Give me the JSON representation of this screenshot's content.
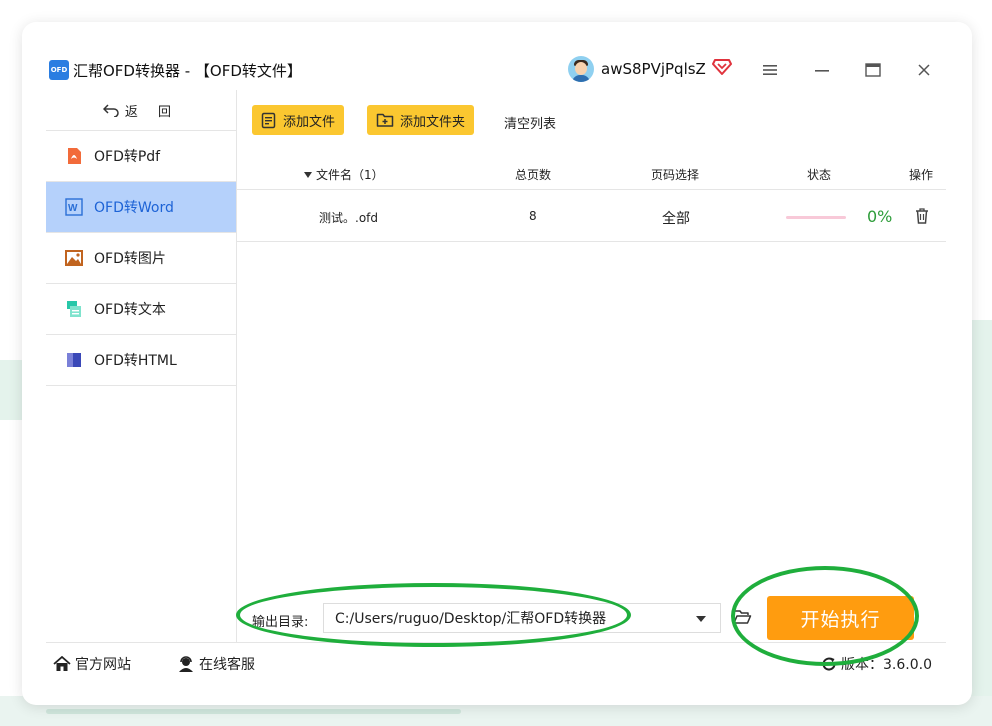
{
  "titlebar": {
    "logo_text": "OFD",
    "title": "汇帮OFD转换器 - 【OFD转文件】",
    "username": "awS8PVjPqlsZ"
  },
  "sidebar": {
    "back_label": "返 回",
    "items": [
      {
        "label": "OFD转Pdf",
        "icon": "pdf-icon",
        "active": false
      },
      {
        "label": "OFD转Word",
        "icon": "word-icon",
        "active": true
      },
      {
        "label": "OFD转图片",
        "icon": "image-icon",
        "active": false
      },
      {
        "label": "OFD转文本",
        "icon": "text-icon",
        "active": false
      },
      {
        "label": "OFD转HTML",
        "icon": "html-icon",
        "active": false
      }
    ]
  },
  "toolbar": {
    "add_file": "添加文件",
    "add_folder": "添加文件夹",
    "clear_list": "清空列表"
  },
  "table": {
    "headers": {
      "name": "文件名（1）",
      "pages": "总页数",
      "range": "页码选择",
      "status": "状态",
      "ops": "操作"
    },
    "rows": [
      {
        "name": "测试。.ofd",
        "pages": "8",
        "range": "全部",
        "progress": "0%",
        "progress_fraction": 0
      }
    ]
  },
  "output": {
    "label": "输出目录:",
    "path": "C:/Users/ruguo/Desktop/汇帮OFD转换器",
    "start_button": "开始执行"
  },
  "footer": {
    "website": "官方网站",
    "support": "在线客服",
    "version_label": "版本：3.6.0.0"
  },
  "colors": {
    "accent_blue": "#1d63d6",
    "active_bg": "#b5d1fb",
    "toolbar_button": "#fbc730",
    "start_button": "#ff9c0f",
    "progress_green": "#2e9d3a",
    "annotation_green": "#1fae3c"
  }
}
